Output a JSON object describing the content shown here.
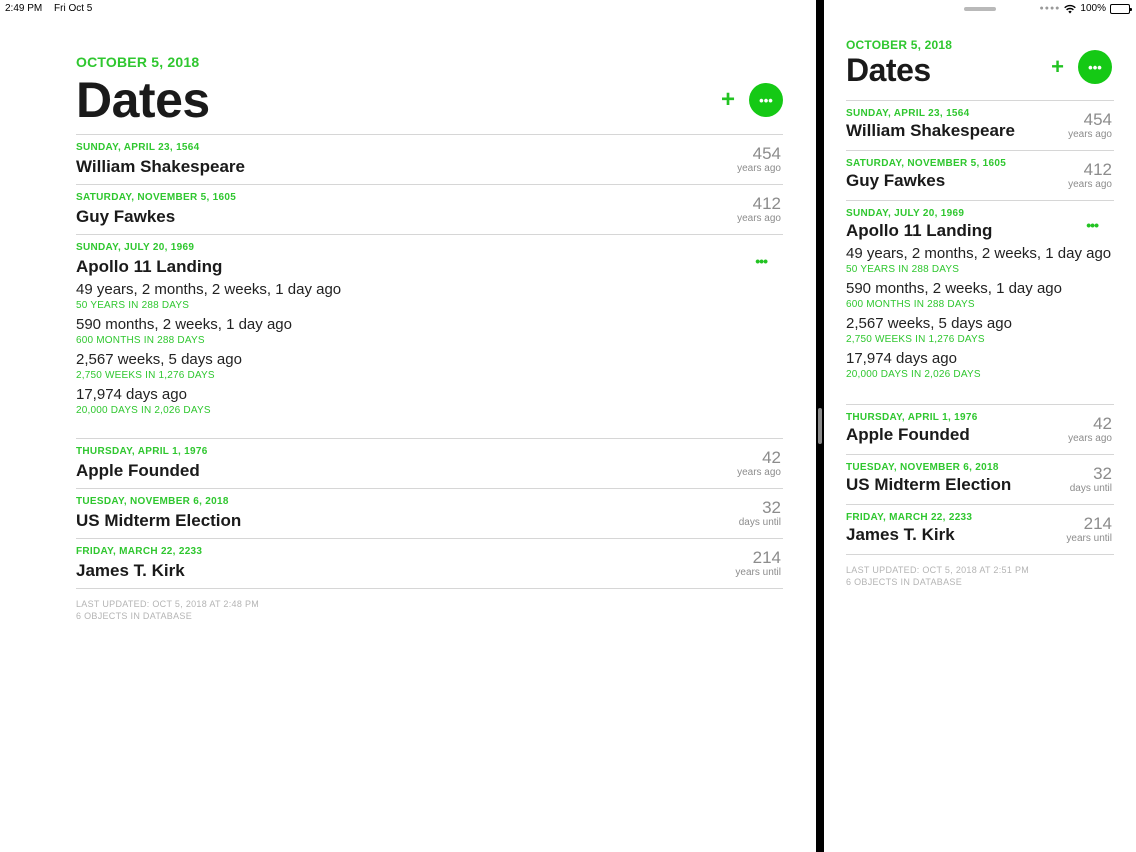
{
  "status_bar": {
    "time": "2:49 PM",
    "date": "Fri Oct 5",
    "battery": "100%",
    "battery_level": 1.0
  },
  "left": {
    "date_label": "OCTOBER 5, 2018",
    "title": "Dates",
    "add_label": "+",
    "more_label": "•••",
    "items": [
      {
        "date": "SUNDAY, APRIL 23, 1564",
        "name": "William Shakespeare",
        "num": "454",
        "unit": "years ago"
      },
      {
        "date": "SATURDAY, NOVEMBER 5, 1605",
        "name": "Guy Fawkes",
        "num": "412",
        "unit": "years ago"
      },
      {
        "date": "SUNDAY, JULY 20, 1969",
        "name": "Apollo 11 Landing",
        "more": "•••",
        "details": [
          {
            "main": "49 years, 2 months, 2 weeks, 1 day ago",
            "sub": "50 YEARS IN 288 DAYS"
          },
          {
            "main": "590 months, 2 weeks, 1 day ago",
            "sub": "600 MONTHS IN 288 DAYS"
          },
          {
            "main": "2,567 weeks, 5 days ago",
            "sub": "2,750 WEEKS IN 1,276 DAYS"
          },
          {
            "main": "17,974 days ago",
            "sub": "20,000 DAYS IN 2,026 DAYS"
          }
        ]
      },
      {
        "date": "THURSDAY, APRIL 1, 1976",
        "name": "Apple Founded",
        "num": "42",
        "unit": "years ago"
      },
      {
        "date": "TUESDAY, NOVEMBER 6, 2018",
        "name": "US Midterm Election",
        "num": "32",
        "unit": "days until"
      },
      {
        "date": "FRIDAY, MARCH 22, 2233",
        "name": "James T. Kirk",
        "num": "214",
        "unit": "years until"
      }
    ],
    "footer_updated": "LAST UPDATED: OCT 5, 2018 AT 2:48 PM",
    "footer_count": "6 OBJECTS IN DATABASE"
  },
  "right": {
    "date_label": "OCTOBER 5, 2018",
    "title": "Dates",
    "add_label": "+",
    "more_label": "•••",
    "items": [
      {
        "date": "SUNDAY, APRIL 23, 1564",
        "name": "William Shakespeare",
        "num": "454",
        "unit": "years ago"
      },
      {
        "date": "SATURDAY, NOVEMBER 5, 1605",
        "name": "Guy Fawkes",
        "num": "412",
        "unit": "years ago"
      },
      {
        "date": "SUNDAY, JULY 20, 1969",
        "name": "Apollo 11 Landing",
        "more": "•••",
        "details": [
          {
            "main": "49 years, 2 months, 2 weeks, 1 day ago",
            "sub": "50 YEARS IN 288 DAYS"
          },
          {
            "main": "590 months, 2 weeks, 1 day ago",
            "sub": "600 MONTHS IN 288 DAYS"
          },
          {
            "main": "2,567 weeks, 5 days ago",
            "sub": "2,750 WEEKS IN 1,276 DAYS"
          },
          {
            "main": "17,974 days ago",
            "sub": "20,000 DAYS IN 2,026 DAYS"
          }
        ]
      },
      {
        "date": "THURSDAY, APRIL 1, 1976",
        "name": "Apple Founded",
        "num": "42",
        "unit": "years ago"
      },
      {
        "date": "TUESDAY, NOVEMBER 6, 2018",
        "name": "US Midterm Election",
        "num": "32",
        "unit": "days until"
      },
      {
        "date": "FRIDAY, MARCH 22, 2233",
        "name": "James T. Kirk",
        "num": "214",
        "unit": "years until"
      }
    ],
    "footer_updated": "LAST UPDATED: OCT 5, 2018 AT 2:51 PM",
    "footer_count": "6 OBJECTS IN DATABASE"
  },
  "colors": {
    "accent": "#2fc72f",
    "button": "#15c915",
    "secondary_text": "#8c8c8c",
    "separator": "#d6d6d6"
  }
}
